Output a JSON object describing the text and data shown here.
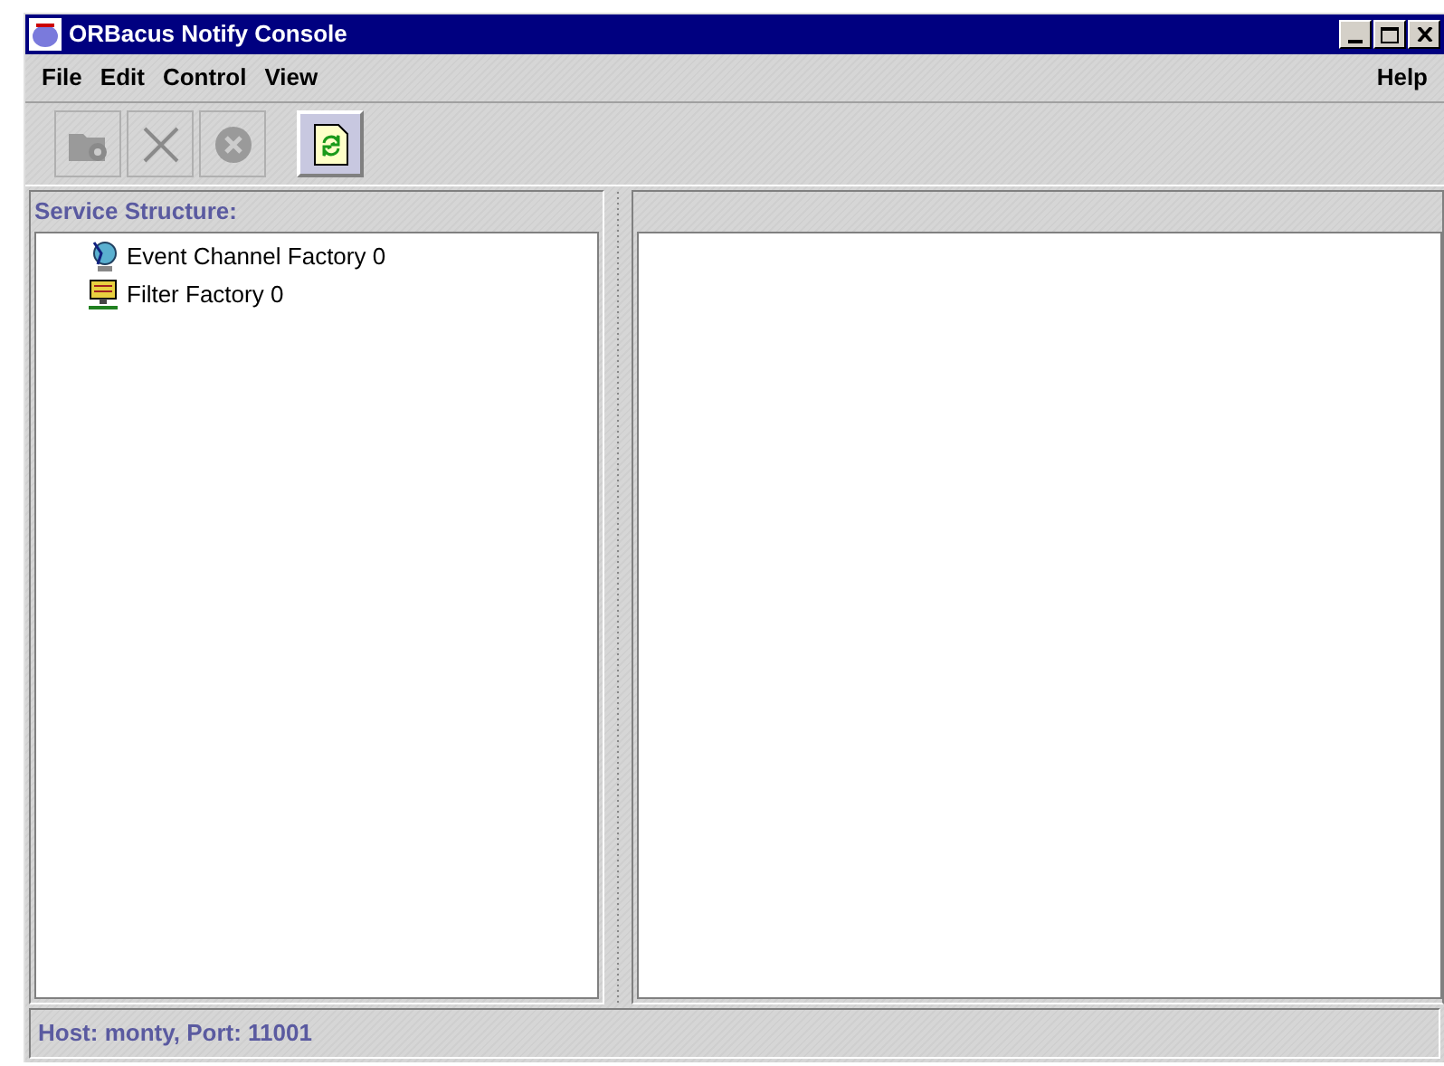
{
  "window": {
    "title": "ORBacus Notify Console"
  },
  "menu": [
    {
      "label": "File"
    },
    {
      "label": "Edit"
    },
    {
      "label": "Control"
    },
    {
      "label": "View"
    }
  ],
  "help_menu": {
    "label": "Help"
  },
  "toolbar": [
    {
      "kind": "add",
      "disabled": true
    },
    {
      "kind": "delete",
      "disabled": true
    },
    {
      "kind": "stop",
      "disabled": true
    },
    {
      "kind": "refresh",
      "disabled": false
    }
  ],
  "tree": {
    "title": "Service Structure:",
    "items": [
      {
        "kind": "channel",
        "label": "Event Channel Factory 0"
      },
      {
        "kind": "filter",
        "label": "Filter Factory 0"
      }
    ]
  },
  "status_bar": "Host: monty, Port: 11001"
}
